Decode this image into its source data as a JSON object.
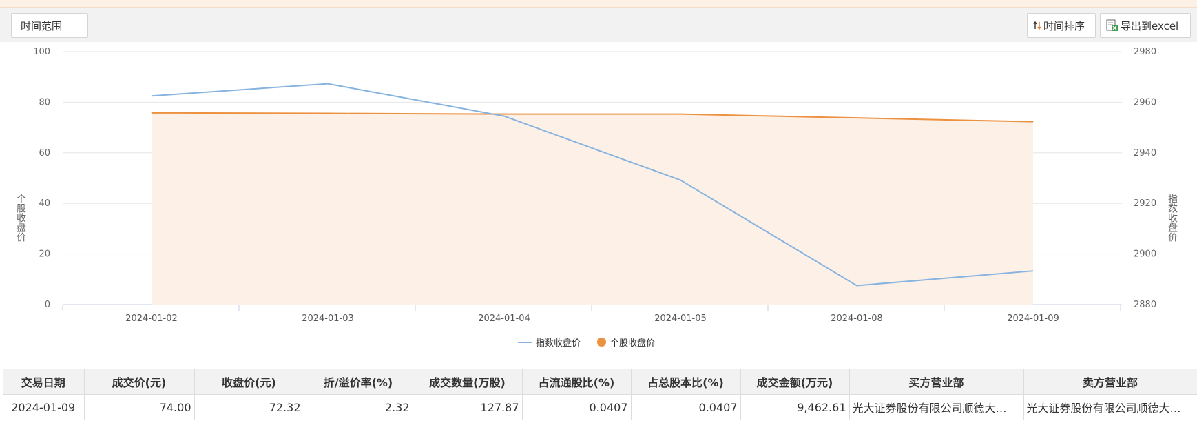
{
  "toolbar": {
    "range_label": "时间范围",
    "sort_label": "时间排序",
    "export_label": "导出到excel"
  },
  "chart_data": {
    "type": "line",
    "categories": [
      "2024-01-02",
      "2024-01-03",
      "2024-01-04",
      "2024-01-05",
      "2024-01-08",
      "2024-01-09"
    ],
    "series": [
      {
        "name": "指数收盘价",
        "axis": "right",
        "color": "#86b3df",
        "values": [
          2962.5,
          2967.3,
          2954.5,
          2929.2,
          2887.5,
          2893.3
        ]
      },
      {
        "name": "个股收盘价",
        "axis": "left",
        "color": "#ec9140",
        "area_color": "#fdf0e6",
        "values": [
          75.8,
          75.6,
          75.3,
          75.3,
          73.8,
          72.3
        ]
      }
    ],
    "y_left": {
      "label": "个股收盘价",
      "ticks": [
        "100",
        "80",
        "60",
        "40",
        "20",
        "0"
      ],
      "range": [
        0,
        100
      ]
    },
    "y_right": {
      "label": "指数收盘价",
      "ticks": [
        "2980",
        "2960",
        "2940",
        "2920",
        "2900",
        "2880"
      ],
      "range": [
        2880,
        2980
      ]
    },
    "grid": true,
    "legend": "bottom-center"
  },
  "table": {
    "headers": [
      "交易日期",
      "成交价(元)",
      "收盘价(元)",
      "折/溢价率(%)",
      "成交数量(万股)",
      "占流通股比(%)",
      "占总股本比(%)",
      "成交金额(万元)",
      "买方营业部",
      "卖方营业部"
    ],
    "rows": [
      [
        "2024-01-09",
        "74.00",
        "72.32",
        "2.32",
        "127.87",
        "0.0407",
        "0.0407",
        "9,462.61",
        "光大证券股份有限公司顺德大…",
        "光大证券股份有限公司顺德大…"
      ]
    ]
  }
}
